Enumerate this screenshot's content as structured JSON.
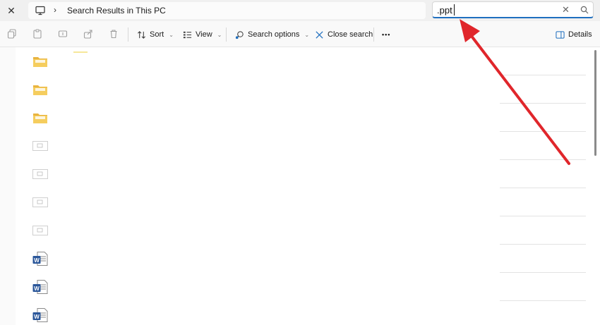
{
  "address_bar": {
    "breadcrumb_chevron": "›",
    "location": "Search Results in This PC"
  },
  "search": {
    "value": ".ppt",
    "clear_glyph": "✕"
  },
  "toolbar": {
    "sort_label": "Sort",
    "view_label": "View",
    "search_options_label": "Search options",
    "close_search_label": "Close search",
    "more_glyph": "•••",
    "details_label": "Details"
  },
  "files": [
    {
      "icon": "folder-icon"
    },
    {
      "icon": "folder-icon"
    },
    {
      "icon": "folder-icon"
    },
    {
      "icon": "image-thumbnail-icon"
    },
    {
      "icon": "image-thumbnail-icon"
    },
    {
      "icon": "image-thumbnail-icon"
    },
    {
      "icon": "image-thumbnail-icon"
    },
    {
      "icon": "word-document-icon"
    },
    {
      "icon": "word-document-icon"
    },
    {
      "icon": "word-document-icon"
    }
  ],
  "colors": {
    "accent": "#1f6fbf",
    "annotation_arrow": "#e0262b",
    "folder": "#f2c14e",
    "word": "#2b579a"
  }
}
